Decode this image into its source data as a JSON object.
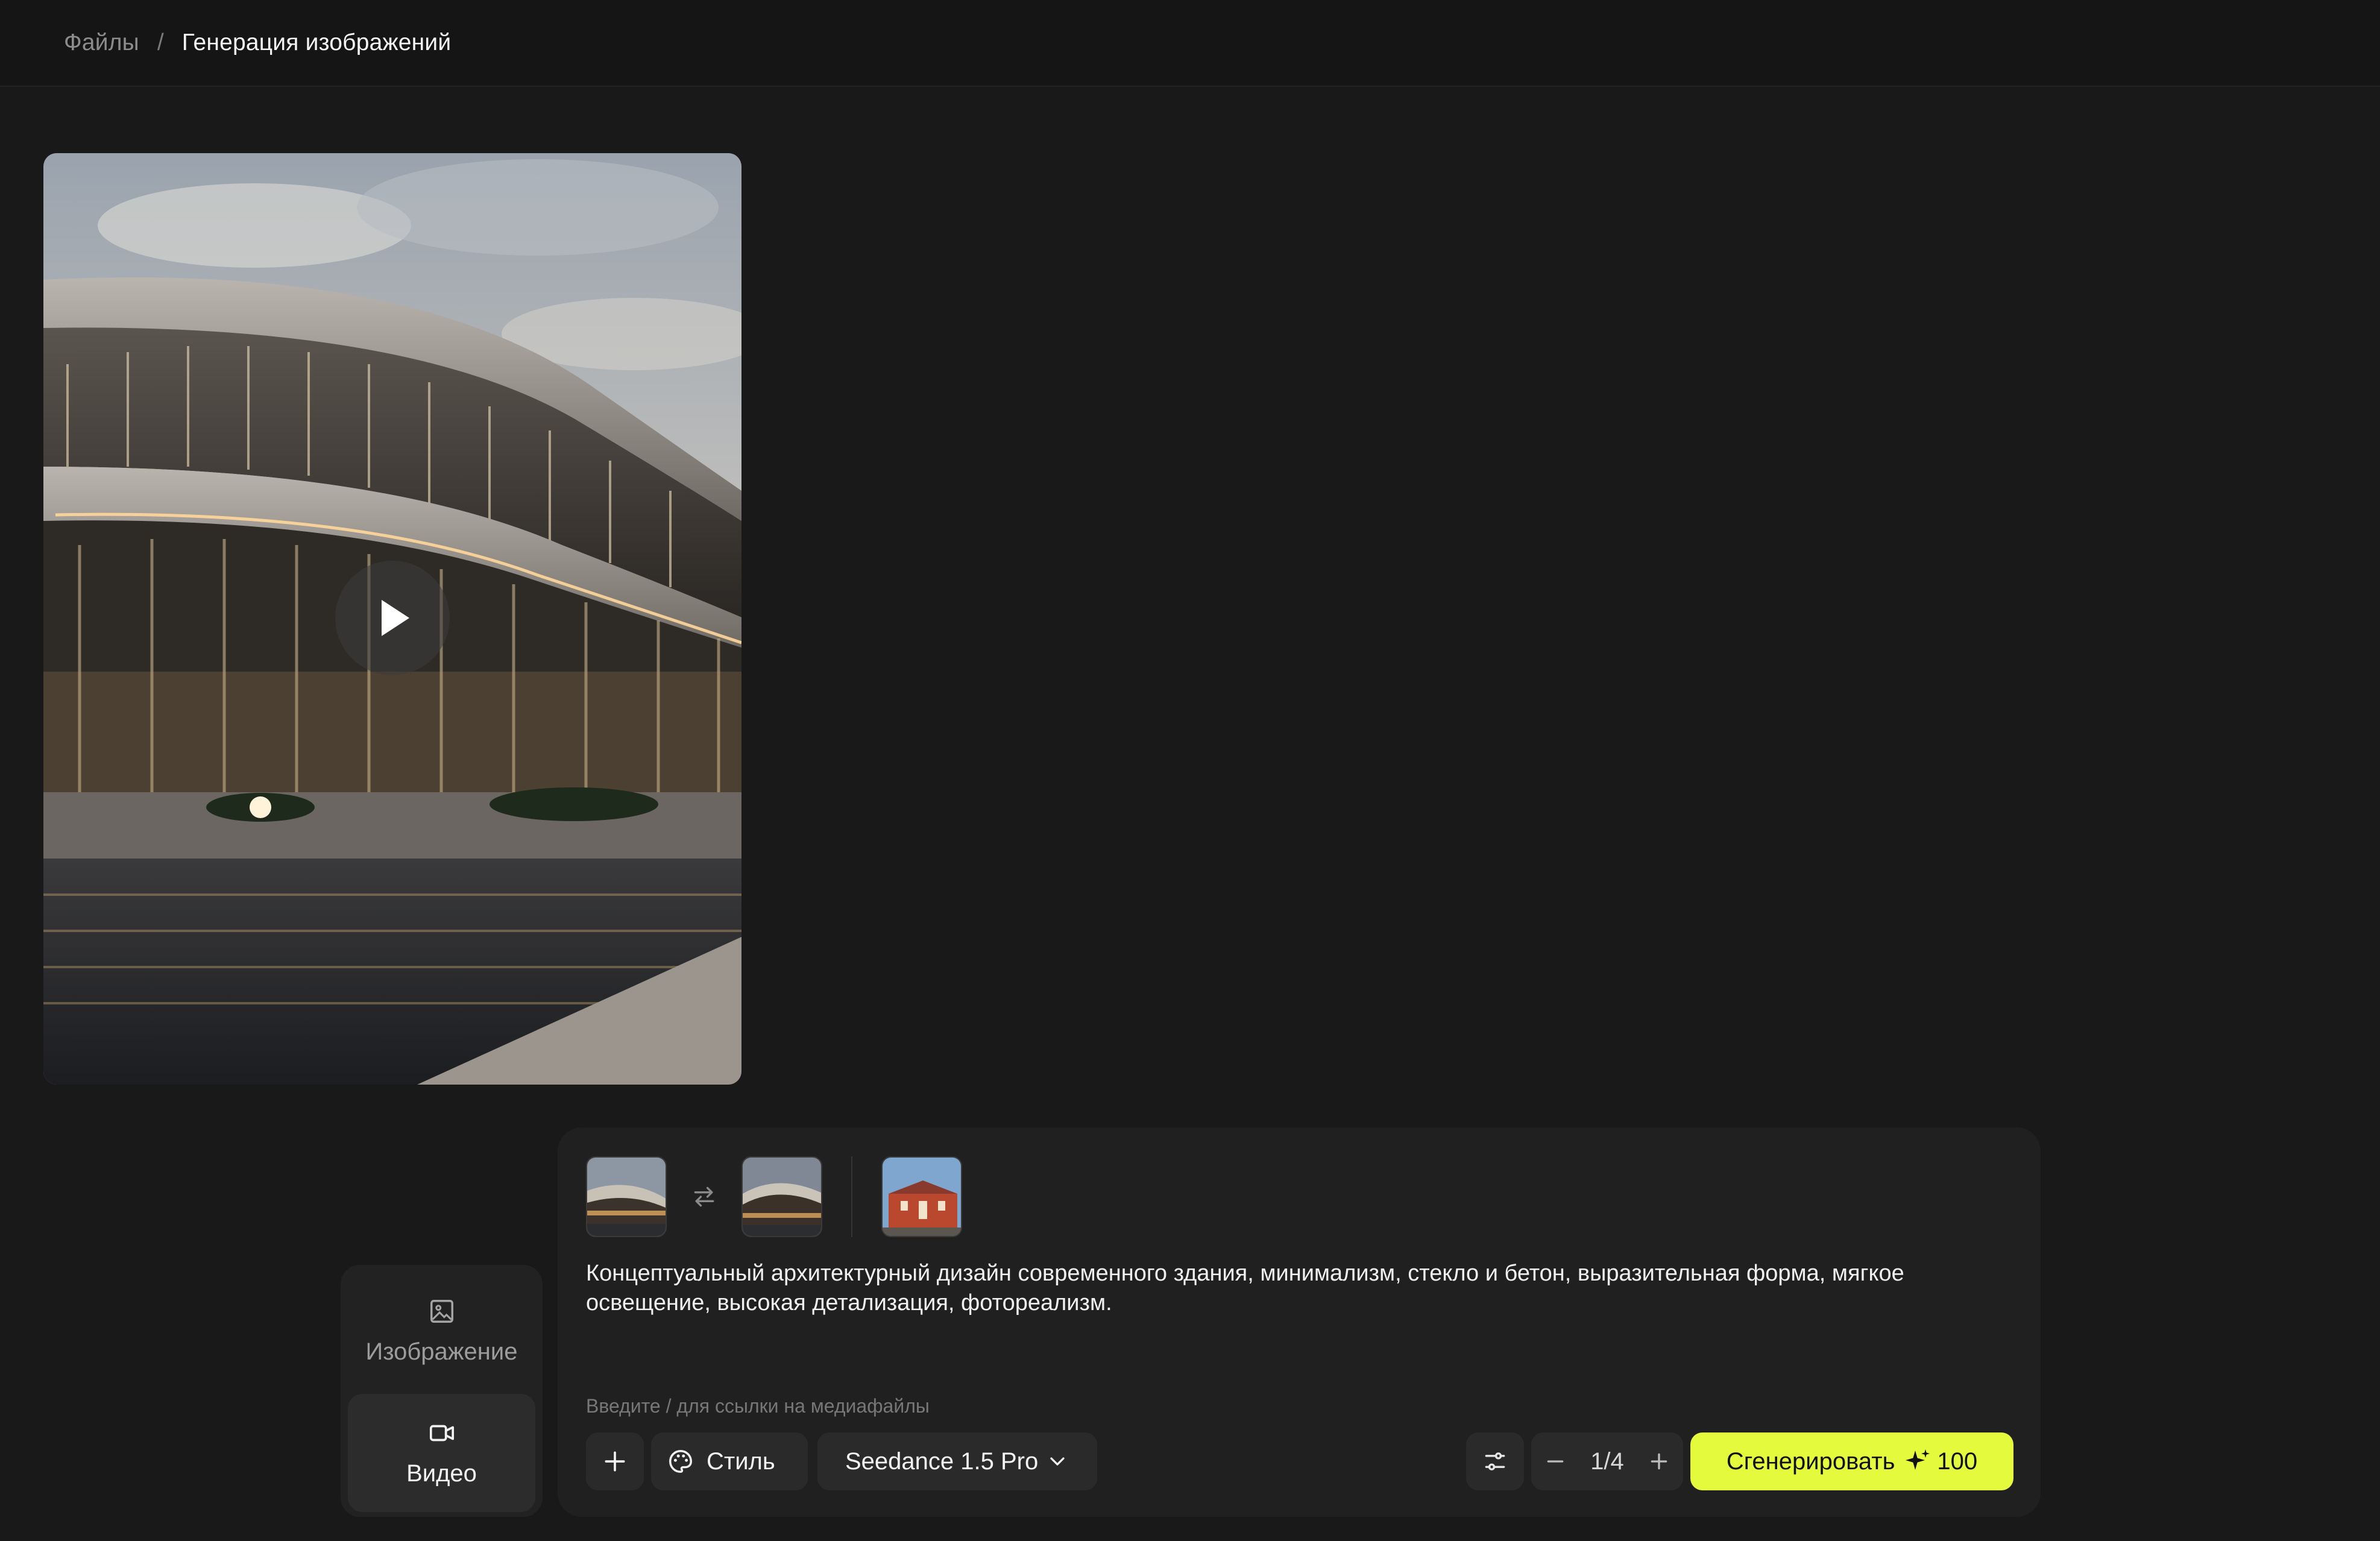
{
  "breadcrumb": {
    "root": "Файлы",
    "separator": "/",
    "current": "Генерация изображений"
  },
  "preview": {
    "media_type": "video",
    "play_icon": "play-icon"
  },
  "modes": [
    {
      "label": "Изображение",
      "icon": "image-icon",
      "active": false
    },
    {
      "label": "Видео",
      "icon": "video-camera-icon",
      "active": true
    }
  ],
  "composer": {
    "prompt": "Концептуальный архитектурный дизайн современного здания, минимализм, стекло и бетон, выразительная форма, мягкое освещение, высокая детализация, фотореализм.",
    "hint": "Введите / для ссылки на медиафайлы",
    "add_icon": "plus-icon",
    "style_label": "Стиль",
    "style_icon": "palette-icon",
    "model_label": "Seedance 1.5 Pro",
    "settings_icon": "sliders-icon",
    "count_display": "1/4",
    "generate_label": "Сгенерировать",
    "generate_cost": "100",
    "accent_color": "#e4fb3d"
  }
}
